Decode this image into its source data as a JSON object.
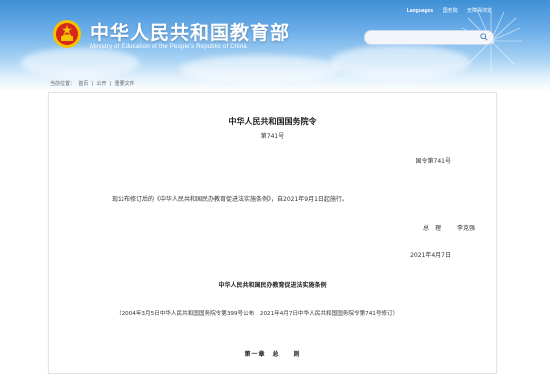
{
  "header": {
    "site_title": "中华人民共和国教育部",
    "site_subtitle": "Ministry of Education of the People's Republic of China",
    "links": {
      "languages": "Languages",
      "link1": "国务院",
      "link2": "无障碍浏览"
    },
    "search": {
      "placeholder": ""
    }
  },
  "breadcrumb": {
    "label": "当前位置：",
    "items": [
      "首页",
      "公开",
      "重要文件"
    ],
    "separator": "|"
  },
  "document": {
    "title": "中华人民共和国国务院令",
    "number": "第741号",
    "order_number": "国令第741号",
    "paragraph": "现公布修订后的《中华人民共和国民办教育促进法实施条例》，自2021年9月1日起施行。",
    "signer_title": "总　理",
    "signer_name": "李克强",
    "date": "2021年4月7日",
    "regulation_title": "中华人民共和国民办教育促进法实施条例",
    "note": "（2004年3月5日中华人民共和国国务院令第399号公布　2021年4月7日中华人民共和国国务院令第741号修订）",
    "chapter": "第一章　总　　则"
  },
  "colors": {
    "header_top": "#3f8fd6",
    "emblem_red": "#d7261d",
    "emblem_gold": "#f5c400"
  }
}
